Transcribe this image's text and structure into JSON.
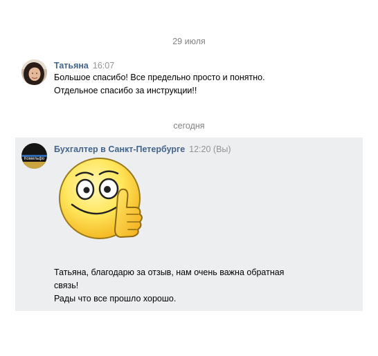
{
  "separators": {
    "first_date": "29 июля",
    "today": "сегодня"
  },
  "messages": [
    {
      "author": "Татьяна",
      "time": "16:07",
      "lines": [
        "Большое спасибо! Все предельно просто и понятно.",
        "Отдельное спасибо за инструкции!!"
      ]
    },
    {
      "author": "Бухгалтер в Санкт-Петербурге",
      "time": "12:20 (Вы)",
      "avatar_text": "Комильфо",
      "sticker": "thumbs-up-smiley-sticker",
      "lines": [
        "Татьяна, благодарю за отзыв, нам очень важна обратная",
        "связь!",
        "Рады что все прошло хорошо."
      ]
    }
  ],
  "colors": {
    "author_link": "#42648b",
    "timestamp": "#939393",
    "separator": "#828282",
    "highlight_bg": "#edeef0"
  }
}
